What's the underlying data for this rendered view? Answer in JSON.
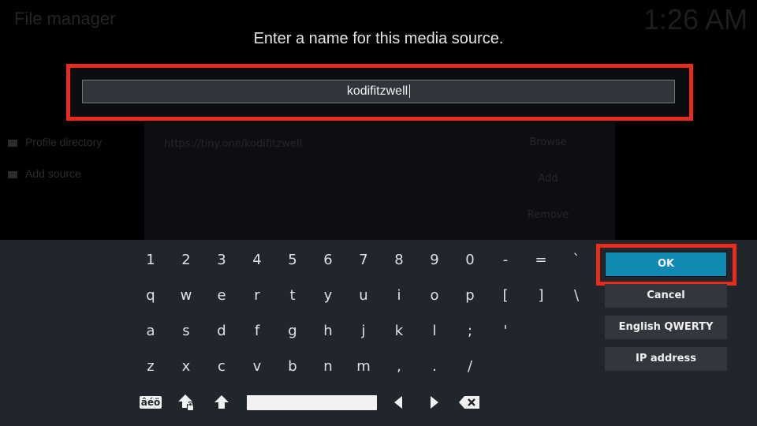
{
  "background": {
    "title": "File manager",
    "clock": "1:26 AM",
    "sidebar": [
      "Profile directory",
      "Add source"
    ],
    "source_url": "https://tiny.one/kodifitzwell",
    "buttons": [
      "Browse",
      "Add",
      "Remove"
    ]
  },
  "dialog": {
    "heading": "Enter a name for this media source.",
    "input_value": "kodifitzwell"
  },
  "keyboard": {
    "rows": [
      [
        "1",
        "2",
        "3",
        "4",
        "5",
        "6",
        "7",
        "8",
        "9",
        "0",
        "-",
        "=",
        "`"
      ],
      [
        "q",
        "w",
        "e",
        "r",
        "t",
        "y",
        "u",
        "i",
        "o",
        "p",
        "[",
        "]",
        "\\"
      ],
      [
        "a",
        "s",
        "d",
        "f",
        "g",
        "h",
        "j",
        "k",
        "l",
        ";",
        "'"
      ],
      [
        "z",
        "x",
        "c",
        "v",
        "b",
        "n",
        "m",
        ",",
        ".",
        "/"
      ]
    ],
    "special": {
      "accents_label": "âéö",
      "shift_lock_icon": "shift-lock-icon",
      "shift_icon": "shift-up-icon",
      "space_icon": "space-bar",
      "left_icon": "arrow-left-icon",
      "right_icon": "arrow-right-icon",
      "backspace_icon": "backspace-icon"
    }
  },
  "side_buttons": {
    "ok": "OK",
    "cancel": "Cancel",
    "layout": "English QWERTY",
    "ip": "IP address"
  },
  "colors": {
    "highlight": "#ea2b1c",
    "ok_focus": "#118ab3",
    "keyboard_bg": "#21262c"
  }
}
